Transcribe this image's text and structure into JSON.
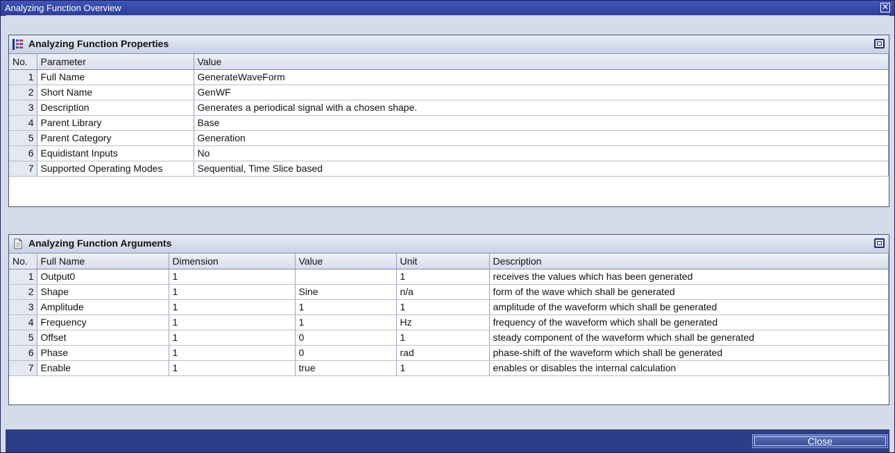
{
  "window": {
    "title": "Analyzing Function Overview"
  },
  "properties": {
    "title": "Analyzing Function Properties",
    "columns": [
      "No.",
      "Parameter",
      "Value"
    ],
    "rows": [
      [
        "1",
        "Full Name",
        "GenerateWaveForm"
      ],
      [
        "2",
        "Short Name",
        "GenWF"
      ],
      [
        "3",
        "Description",
        "Generates a periodical signal with a chosen shape."
      ],
      [
        "4",
        "Parent Library",
        "Base"
      ],
      [
        "5",
        "Parent Category",
        "Generation"
      ],
      [
        "6",
        "Equidistant Inputs",
        "No"
      ],
      [
        "7",
        "Supported Operating Modes",
        "Sequential, Time Slice based"
      ]
    ]
  },
  "arguments": {
    "title": "Analyzing Function Arguments",
    "columns": [
      "No.",
      "Full Name",
      "Dimension",
      "Value",
      "Unit",
      "Description"
    ],
    "rows": [
      [
        "1",
        "Output0",
        "1",
        "",
        "1",
        "receives the values which has been generated"
      ],
      [
        "2",
        "Shape",
        "1",
        "Sine",
        "n/a",
        "form of the wave which shall be generated"
      ],
      [
        "3",
        "Amplitude",
        "1",
        "1",
        "1",
        "amplitude of the waveform which shall be generated"
      ],
      [
        "4",
        "Frequency",
        "1",
        "1",
        "Hz",
        "frequency of the waveform which shall be generated"
      ],
      [
        "5",
        "Offset",
        "1",
        "0",
        "1",
        "steady component of the waveform which shall be generated"
      ],
      [
        "6",
        "Phase",
        "1",
        "0",
        "rad",
        "phase-shift of the waveform which shall be generated"
      ],
      [
        "7",
        "Enable",
        "1",
        "true",
        "1",
        "enables or disables the internal calculation"
      ]
    ]
  },
  "footer": {
    "close_label": "Close"
  }
}
